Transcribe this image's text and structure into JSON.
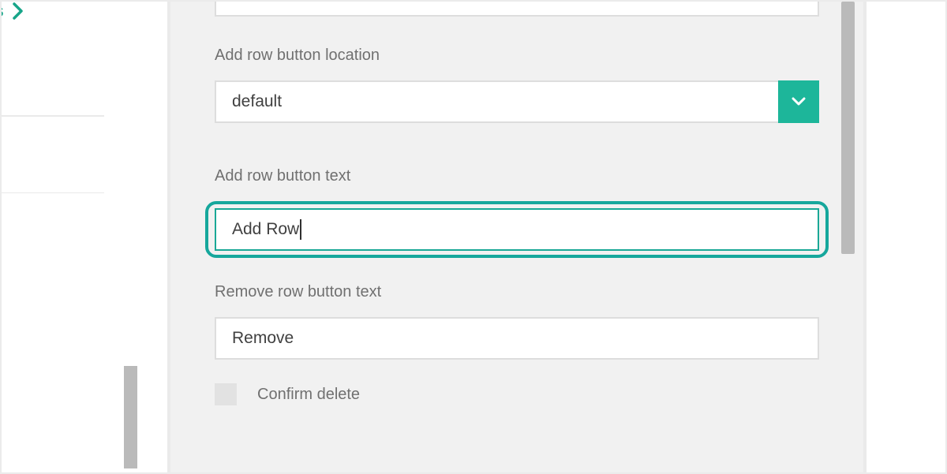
{
  "sidebar": {
    "active_item_fragment": "erties"
  },
  "form": {
    "add_row_button_location": {
      "label": "Add row button location",
      "value": "default"
    },
    "add_row_button_text": {
      "label": "Add row button text",
      "value": "Add Row"
    },
    "remove_row_button_text": {
      "label": "Remove row button text",
      "value": "Remove"
    },
    "confirm_delete": {
      "label": "Confirm delete",
      "checked": false
    }
  },
  "colors": {
    "accent": "#17a589"
  }
}
